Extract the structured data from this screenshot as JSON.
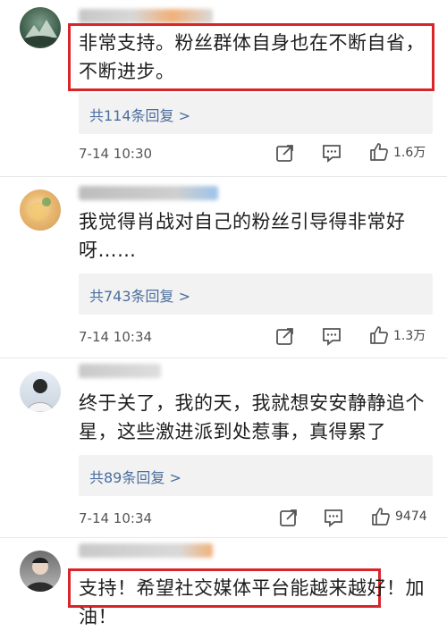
{
  "comments": [
    {
      "text": "非常支持。粉丝群体自身也在不断自省，不断进步。",
      "replies": "共114条回复 >",
      "time": "7-14 10:30",
      "likes": "1.6万"
    },
    {
      "text": "我觉得肖战对自己的粉丝引导得非常好呀……",
      "replies": "共743条回复 >",
      "time": "7-14 10:34",
      "likes": "1.3万"
    },
    {
      "text": "终于关了，我的天，我就想安安静静追个星，这些激进派到处惹事，真得累了",
      "replies": "共89条回复 >",
      "time": "7-14 10:34",
      "likes": "9474"
    },
    {
      "text": "支持！希望社交媒体平台能越来越好！加油！"
    }
  ],
  "icons": {
    "share": "share-icon",
    "comment": "comment-icon",
    "like": "thumbs-up-icon"
  },
  "colors": {
    "highlight": "#d9242a",
    "reply_link": "#4a6ea0"
  }
}
